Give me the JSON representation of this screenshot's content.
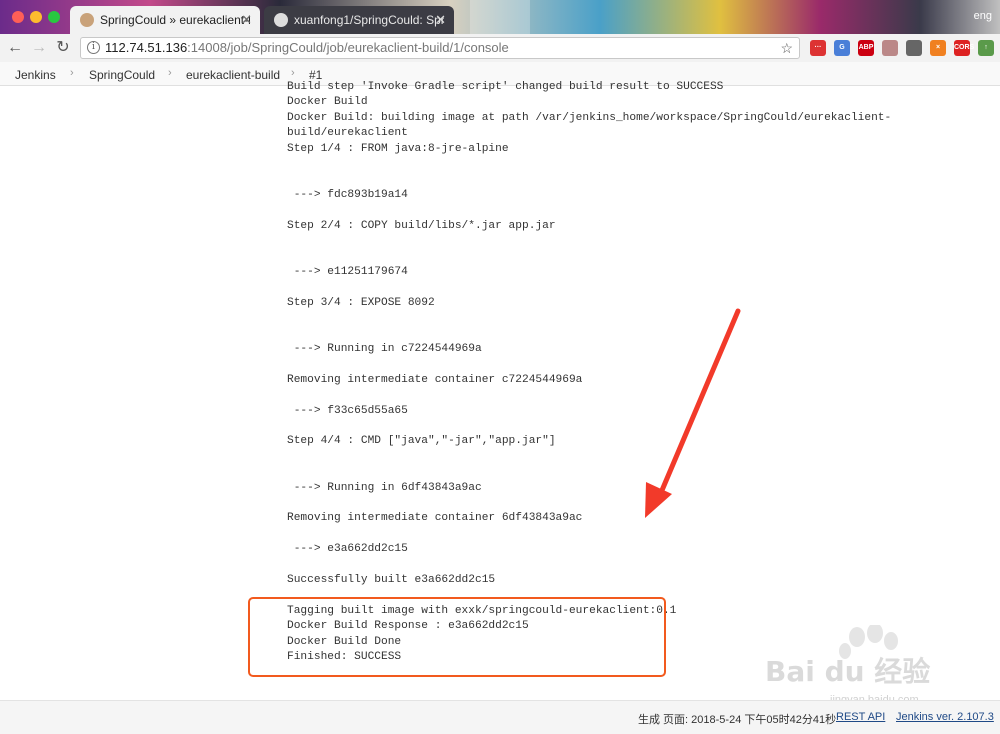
{
  "browser": {
    "tabs": [
      {
        "title": "SpringCould » eurekaclient-bu"
      },
      {
        "title": "xuanfong1/SpringCould: Spri"
      }
    ],
    "profile_label": "eng",
    "url": {
      "host": "112.74.51.136",
      "rest": ":14008/job/SpringCould/job/eurekaclient-build/1/console"
    },
    "extensions": [
      {
        "icon": "dots-extension-icon",
        "label": "···",
        "color": "#d33"
      },
      {
        "icon": "translate-extension-icon",
        "label": "G",
        "color": "#4a7fd8"
      },
      {
        "icon": "adblock-extension-icon",
        "label": "ABP",
        "color": "#c01"
      },
      {
        "icon": "circle-extension-icon",
        "label": "",
        "color": "#b88"
      },
      {
        "icon": "window-extension-icon",
        "label": "",
        "color": "#666"
      },
      {
        "icon": "x-extension-icon",
        "label": "×",
        "color": "#f08020"
      },
      {
        "icon": "cors-extension-icon",
        "label": "CORS",
        "color": "#d22"
      },
      {
        "icon": "arrow-extension-icon",
        "label": "↑",
        "color": "#5a9a4a"
      }
    ]
  },
  "breadcrumb": [
    "Jenkins",
    "SpringCould",
    "eurekaclient-build",
    "#1"
  ],
  "console_lines": [
    "Build step 'Invoke Gradle script' changed build result to SUCCESS",
    "Docker Build",
    "Docker Build: building image at path /var/jenkins_home/workspace/SpringCould/eurekaclient-",
    "build/eurekaclient",
    "Step 1/4 : FROM java:8-jre-alpine",
    "",
    "",
    " ---> fdc893b19a14",
    "",
    "Step 2/4 : COPY build/libs/*.jar app.jar",
    "",
    "",
    " ---> e11251179674",
    "",
    "Step 3/4 : EXPOSE 8092",
    "",
    "",
    " ---> Running in c7224544969a",
    "",
    "Removing intermediate container c7224544969a",
    "",
    " ---> f33c65d55a65",
    "",
    "Step 4/4 : CMD [\"java\",\"-jar\",\"app.jar\"]",
    "",
    "",
    " ---> Running in 6df43843a9ac",
    "",
    "Removing intermediate container 6df43843a9ac",
    "",
    " ---> e3a662dd2c15",
    "",
    "Successfully built e3a662dd2c15",
    "",
    "Tagging built image with exxk/springcould-eurekaclient:0.1",
    "Docker Build Response : e3a662dd2c15",
    "Docker Build Done",
    "Finished: SUCCESS"
  ],
  "footer": {
    "generated": "生成 页面: 2018-5-24 下午05时42分41秒",
    "rest_api": "REST API",
    "version": "Jenkins ver. 2.107.3"
  },
  "watermark": {
    "brand": "Bai du 经验",
    "sub": "jingyan.baidu.com"
  },
  "colors": {
    "highlight": "#f25a1e",
    "arrow": "#f23a2a",
    "link": "#204a87"
  }
}
